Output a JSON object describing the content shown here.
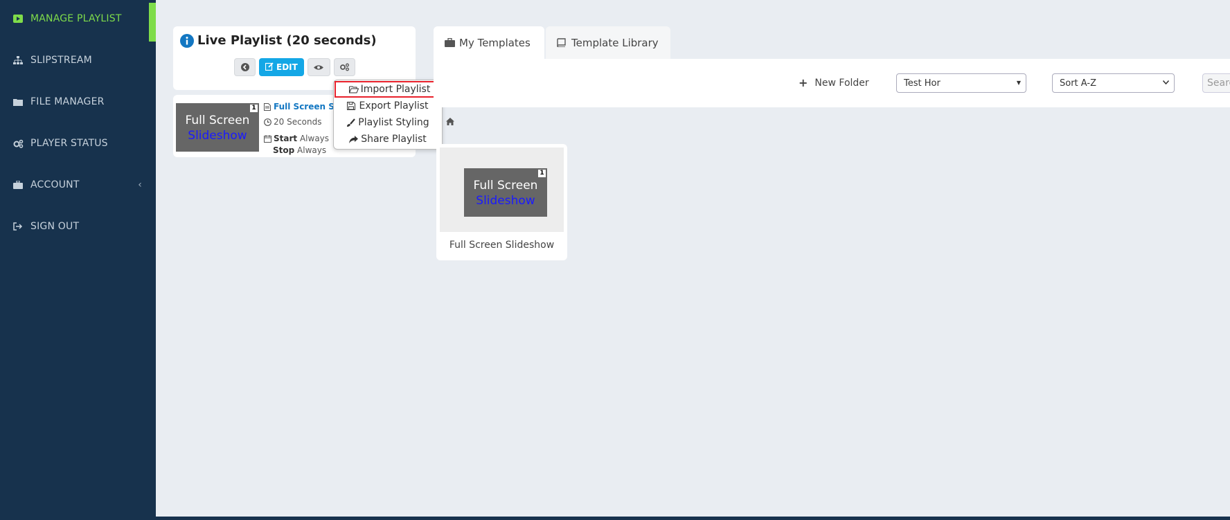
{
  "sidebar": {
    "items": [
      {
        "label": "MANAGE PLAYLIST",
        "icon": "play-icon",
        "active": true
      },
      {
        "label": "SLIPSTREAM",
        "icon": "sitemap-icon"
      },
      {
        "label": "FILE MANAGER",
        "icon": "folder-icon"
      },
      {
        "label": "PLAYER STATUS",
        "icon": "gears-icon"
      },
      {
        "label": "ACCOUNT",
        "icon": "briefcase-icon",
        "chevron": "‹"
      },
      {
        "label": "SIGN OUT",
        "icon": "sign-out-icon"
      }
    ],
    "active_color": "#7fdc4a",
    "background": "#17324d"
  },
  "playlist": {
    "title": "Live Playlist (20 seconds)",
    "edit_label": "EDIT",
    "item": {
      "name": "Full Screen Slid",
      "duration": "20 Seconds",
      "start_label": "Start",
      "start_value": "Always",
      "stop_label": "Stop",
      "stop_value": "Always",
      "thumb_line1": "Full Screen",
      "thumb_line2": "Slideshow",
      "thumb_badge": "1"
    }
  },
  "dropdown": {
    "items": [
      {
        "label": "Import Playlist",
        "icon": "folder-open-icon",
        "highlighted": true
      },
      {
        "label": "Export Playlist",
        "icon": "save-icon"
      },
      {
        "label": "Playlist Styling",
        "icon": "brush-icon"
      },
      {
        "label": "Share Playlist",
        "icon": "share-icon"
      }
    ]
  },
  "tabs": [
    {
      "label": "My Templates",
      "icon": "briefcase-icon",
      "active": true
    },
    {
      "label": "Template Library",
      "icon": "book-icon",
      "active": false
    }
  ],
  "toolbar": {
    "new_folder_label": "New Folder",
    "folder_select_value": "Test Hor",
    "sort_select_value": "Sort A-Z",
    "search_placeholder": "Search"
  },
  "templates": [
    {
      "caption": "Full Screen Slideshow",
      "thumb_line1": "Full Screen",
      "thumb_line2": "Slideshow",
      "thumb_badge": "1"
    }
  ]
}
